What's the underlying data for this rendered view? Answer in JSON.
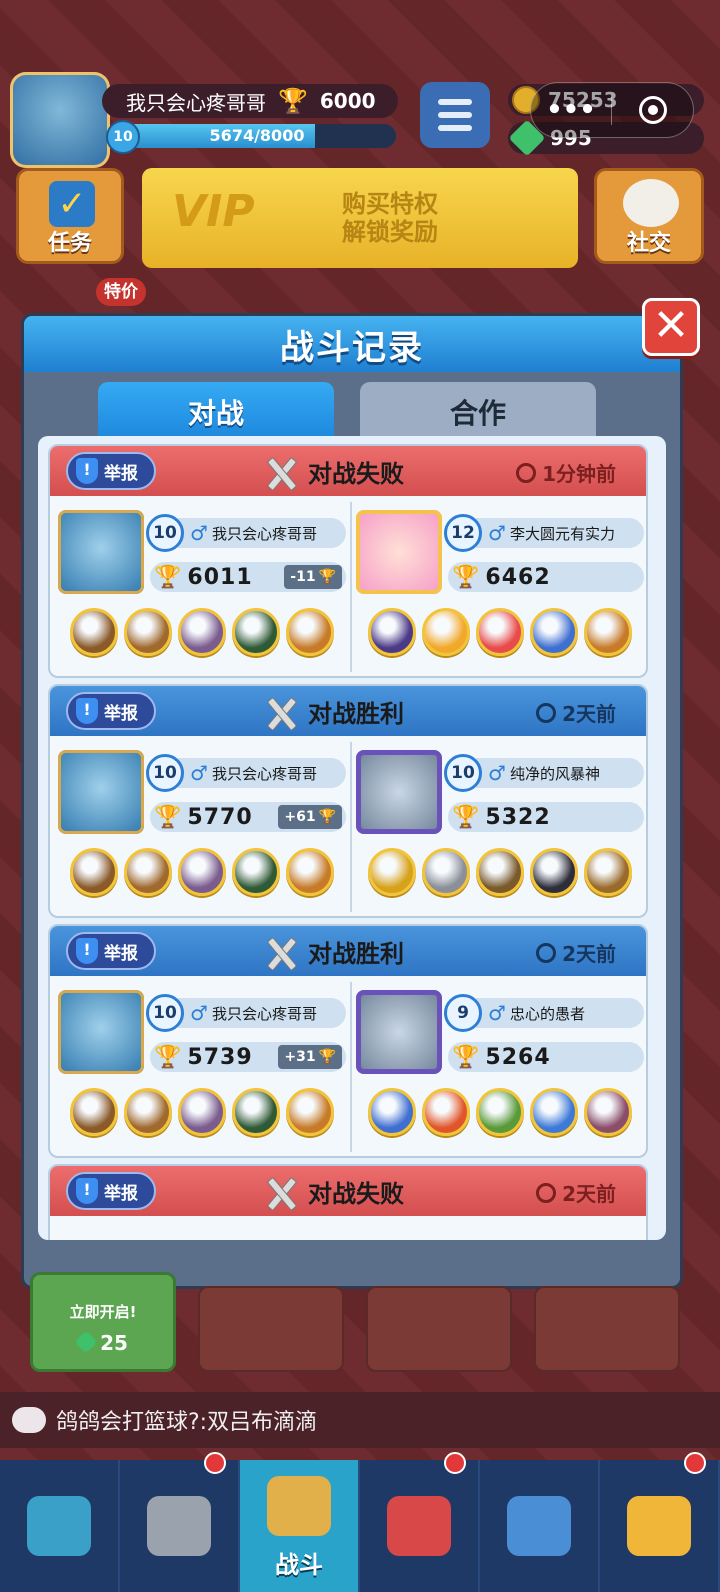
{
  "hud": {
    "player_name": "我只会心疼哥哥",
    "trophies": "6000",
    "level": "10",
    "xp_text": "5674/8000",
    "xp_fraction": 0.71,
    "coins": "75253",
    "gems": "995",
    "capsule_dots": "•••"
  },
  "buttons": {
    "task_label": "任务",
    "vip_text_line1": "购买特权",
    "vip_text_line2": "解锁奖励",
    "vip_word": "VIP",
    "social_label": "社交",
    "special_price": "特价"
  },
  "modal": {
    "title": "战斗记录",
    "close": "✕",
    "tabs": [
      {
        "label": "对战",
        "active": true
      },
      {
        "label": "合作",
        "active": false
      }
    ]
  },
  "records": [
    {
      "result": "对战失败",
      "type": "lose",
      "time": "1分钟前",
      "report": "举报",
      "me": {
        "level": "10",
        "name": "我只会心疼哥哥",
        "trophies": "6011",
        "delta": "-11"
      },
      "opp": {
        "level": "12",
        "name": "李大圆元有实力",
        "trophies": "6462",
        "frame": "pink"
      },
      "my_heroes": [
        "#8b5a2b",
        "#a0692e",
        "#7a5c8e",
        "#2f5a36",
        "#c77b2a"
      ],
      "opp_heroes": [
        "#4b3a87",
        "#f2a82a",
        "#e84b4b",
        "#3f6fd0",
        "#c77b2a"
      ]
    },
    {
      "result": "对战胜利",
      "type": "win",
      "time": "2天前",
      "report": "举报",
      "me": {
        "level": "10",
        "name": "我只会心疼哥哥",
        "trophies": "5770",
        "delta": "+61"
      },
      "opp": {
        "level": "10",
        "name": "纯净的风暴神",
        "trophies": "5322",
        "frame": "purple"
      },
      "my_heroes": [
        "#8b5a2b",
        "#a0692e",
        "#7a5c8e",
        "#2f5a36",
        "#c77b2a"
      ],
      "opp_heroes": [
        "#d6a21c",
        "#8b8f98",
        "#7a5a2b",
        "#2e2e3a",
        "#9a6a2a"
      ]
    },
    {
      "result": "对战胜利",
      "type": "win",
      "time": "2天前",
      "report": "举报",
      "me": {
        "level": "10",
        "name": "我只会心疼哥哥",
        "trophies": "5739",
        "delta": "+31"
      },
      "opp": {
        "level": "9",
        "name": "忠心的愚者",
        "trophies": "5264",
        "frame": "purple"
      },
      "my_heroes": [
        "#8b5a2b",
        "#a0692e",
        "#7a5c8e",
        "#2f5a36",
        "#c77b2a"
      ],
      "opp_heroes": [
        "#3f6fd0",
        "#e0562a",
        "#5a9a3a",
        "#3d7ad8",
        "#8a4e6a"
      ]
    },
    {
      "result": "对战失败",
      "type": "lose",
      "time": "2天前",
      "report": "举报"
    }
  ],
  "chest": {
    "label": "立即开启!",
    "cost": "25"
  },
  "chat": {
    "text": "鸽鸽会打篮球?:双吕布滴滴"
  },
  "nav": [
    {
      "name": "shop",
      "label": "",
      "color": "#3aa0c8",
      "dot": false
    },
    {
      "name": "heroes",
      "label": "",
      "color": "#9aa2ad",
      "dot": true
    },
    {
      "name": "battle",
      "label": "战斗",
      "color": "#e2b04a",
      "dot": false,
      "active": true
    },
    {
      "name": "ranking",
      "label": "",
      "color": "#d94848",
      "dot": true
    },
    {
      "name": "team",
      "label": "",
      "color": "#4a8fd6",
      "dot": false
    },
    {
      "name": "explore",
      "label": "",
      "color": "#f0b63a",
      "dot": true
    }
  ]
}
